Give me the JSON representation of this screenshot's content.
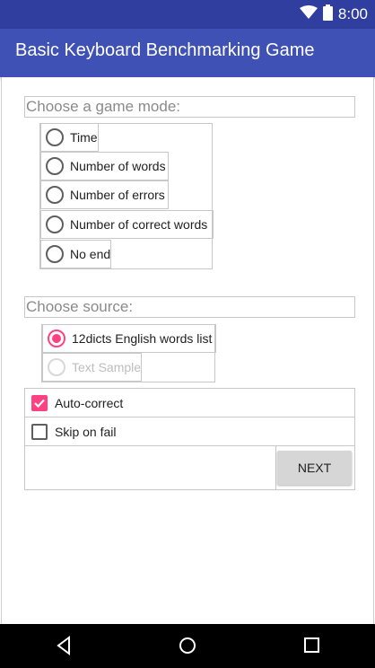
{
  "status_bar": {
    "time": "8:00",
    "icons": [
      "wifi-icon",
      "battery-icon"
    ]
  },
  "app_bar": {
    "title": "Basic Keyboard Benchmarking Game"
  },
  "game_mode": {
    "label": "Choose a game mode:",
    "options": [
      {
        "label": "Time",
        "selected": false
      },
      {
        "label": "Number of words",
        "selected": false
      },
      {
        "label": "Number of errors",
        "selected": false
      },
      {
        "label": "Number of correct words",
        "selected": false
      },
      {
        "label": "No end",
        "selected": false
      }
    ]
  },
  "source": {
    "label": "Choose source:",
    "options": [
      {
        "label": "12dicts English words list",
        "selected": true,
        "enabled": true
      },
      {
        "label": "Text Sample",
        "selected": false,
        "enabled": false
      }
    ]
  },
  "options": {
    "auto_correct": {
      "label": "Auto-correct",
      "checked": true
    },
    "skip_on_fail": {
      "label": "Skip on fail",
      "checked": false
    }
  },
  "actions": {
    "next_label": "NEXT"
  },
  "nav_bar": {
    "icons": [
      "back-icon",
      "home-icon",
      "recents-icon"
    ]
  },
  "colors": {
    "status_bar": "#303f9f",
    "app_bar": "#3f51b5",
    "accent": "#ff4081"
  }
}
